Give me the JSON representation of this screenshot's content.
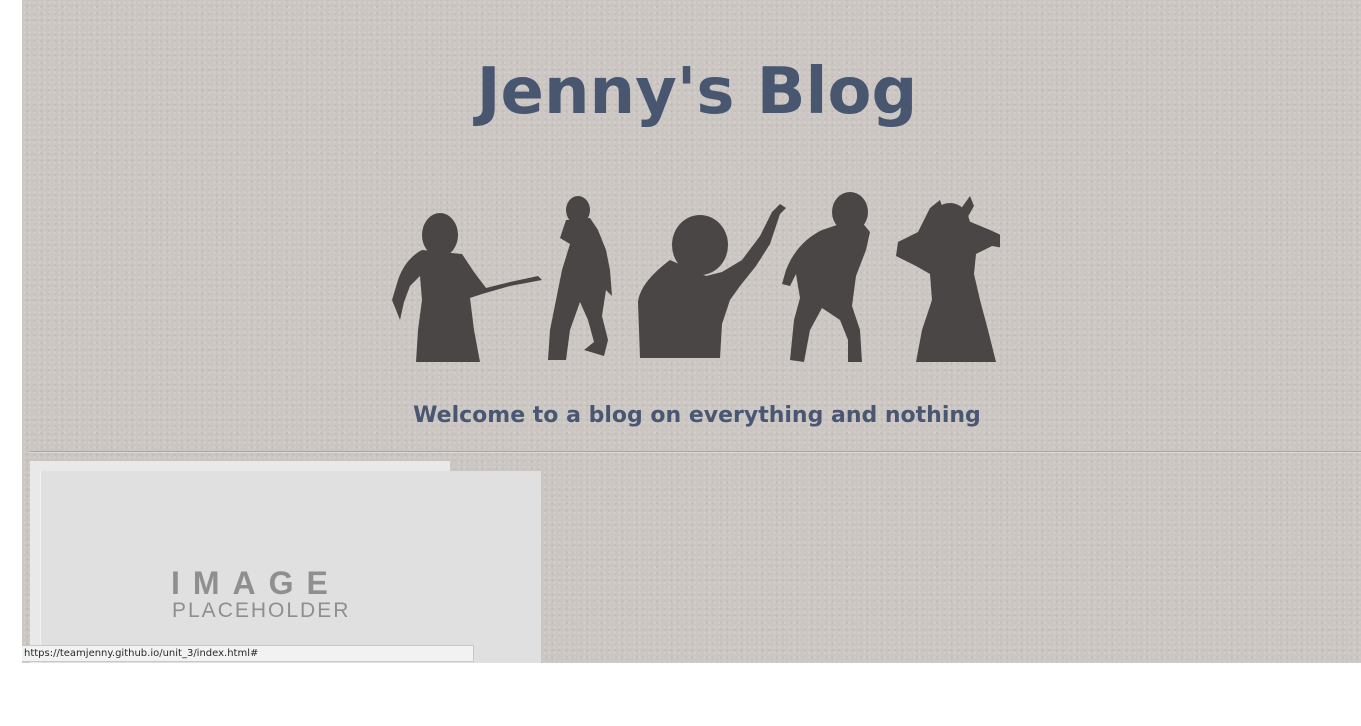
{
  "header": {
    "title": "Jenny's Blog",
    "tagline": "Welcome to a blog on everything and nothing"
  },
  "hero": {
    "description_icon": "dancer-silhouettes-icon",
    "silhouette_color": "#4a4645"
  },
  "post": {
    "image_placeholder_title": "IMAGE",
    "image_placeholder_subtitle": "PLACEHOLDER"
  },
  "status_bar": {
    "url": "https://teamjenny.github.io/unit_3/index.html#"
  },
  "colors": {
    "title": "#485670",
    "background": "#cbc6c2"
  }
}
